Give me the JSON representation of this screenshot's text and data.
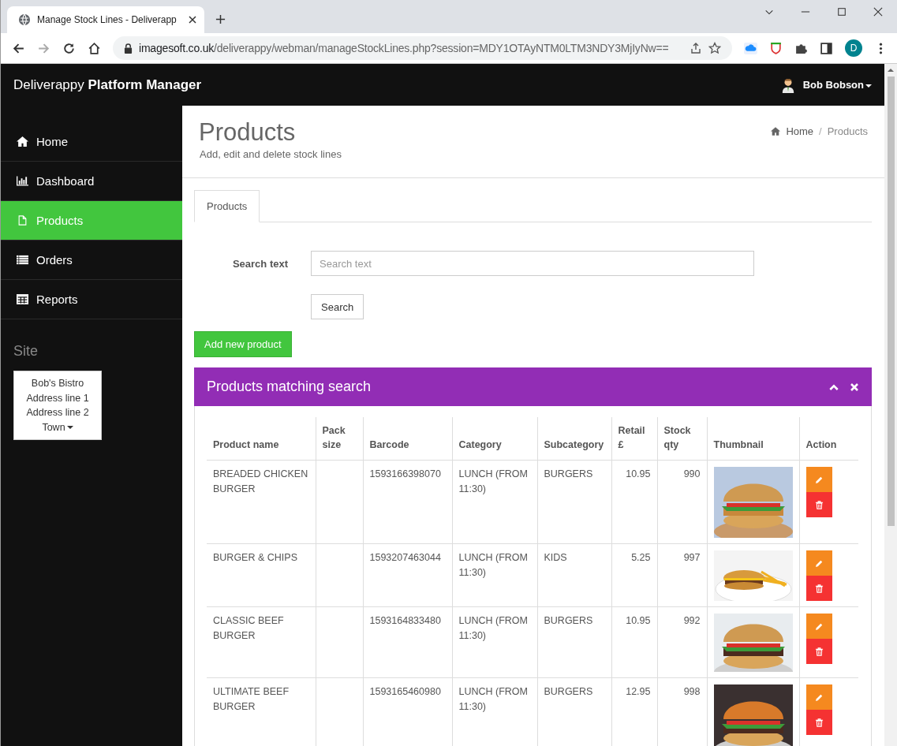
{
  "browser": {
    "tab_title": "Manage Stock Lines - Deliverapp",
    "url_host": "imagesoft.co.uk",
    "url_path": "/deliverappy/webman/manageStockLines.php?session=MDY1OTAyNTM0LTM3NDY3MjIyNw==",
    "profile": "D"
  },
  "header": {
    "brand": "Deliverappy **Platform Manager**",
    "user": "Bob Bobson"
  },
  "sidebar": {
    "items": [
      {
        "label": "Home",
        "kind": "home",
        "selected": false
      },
      {
        "label": "Dashboard",
        "kind": "chart",
        "selected": false
      },
      {
        "label": "Products",
        "kind": "file",
        "selected": true
      },
      {
        "label": "Orders",
        "kind": "list",
        "selected": false
      },
      {
        "label": "Reports",
        "kind": "table",
        "selected": false
      }
    ],
    "site_heading": "Site",
    "site_lines": [
      "Bob's Bistro",
      "Address line 1",
      "Address line 2",
      "Town"
    ]
  },
  "page": {
    "title": "Products",
    "subtitle": "Add, edit and delete stock lines",
    "breadcrumb": [
      "Home",
      "Products"
    ],
    "breadcrumb_separator": "/"
  },
  "tabs": [
    {
      "label": "Products",
      "selected": true
    }
  ],
  "search": {
    "label": "Search text",
    "placeholder": "Search text",
    "button": "Search"
  },
  "add_button": "Add new product",
  "panel": {
    "title": "Products matching search",
    "columns": [
      "Product name",
      "Pack size",
      "Barcode",
      "Category",
      "Subcategory",
      "Retail £",
      "Stock qty",
      "Thumbnail",
      "Action"
    ],
    "rows": [
      {
        "name": "BREADED CHICKEN BURGER",
        "pack_size": "",
        "barcode": "1593166398070",
        "category": "LUNCH (FROM 11:30)",
        "subcategory": "BURGERS",
        "retail": "10.95",
        "stock": "990"
      },
      {
        "name": "BURGER & CHIPS",
        "pack_size": "",
        "barcode": "1593207463044",
        "category": "LUNCH (FROM 11:30)",
        "subcategory": "KIDS",
        "retail": "5.25",
        "stock": "997"
      },
      {
        "name": "CLASSIC BEEF BURGER",
        "pack_size": "",
        "barcode": "1593164833480",
        "category": "LUNCH (FROM 11:30)",
        "subcategory": "BURGERS",
        "retail": "10.95",
        "stock": "992"
      },
      {
        "name": "ULTIMATE BEEF BURGER",
        "pack_size": "",
        "barcode": "1593165460980",
        "category": "LUNCH (FROM 11:30)",
        "subcategory": "BURGERS",
        "retail": "12.95",
        "stock": "998"
      }
    ]
  }
}
